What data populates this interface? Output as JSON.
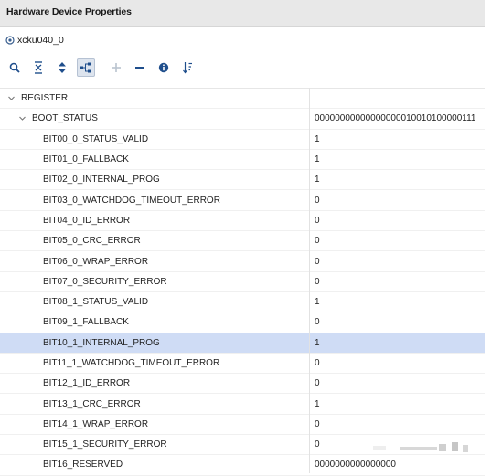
{
  "panel": {
    "title": "Hardware Device Properties",
    "device": "xcku040_0"
  },
  "toolbar": {
    "buttons": [
      {
        "name": "search",
        "icon": "search-icon"
      },
      {
        "name": "collapse-all",
        "icon": "collapse-all-icon"
      },
      {
        "name": "expand-all",
        "icon": "expand-all-icon"
      },
      {
        "name": "group",
        "icon": "hierarchy-icon",
        "active": true
      },
      {
        "name": "add",
        "icon": "plus-icon",
        "disabled": true
      },
      {
        "name": "remove",
        "icon": "minus-icon"
      },
      {
        "name": "info",
        "icon": "info-icon"
      },
      {
        "name": "sort",
        "icon": "sort-icon"
      }
    ]
  },
  "tree": {
    "root": {
      "name": "REGISTER",
      "value": ""
    },
    "group": {
      "name": "BOOT_STATUS",
      "value": "00000000000000000010010100000111"
    },
    "bits": [
      {
        "name": "BIT00_0_STATUS_VALID",
        "value": "1"
      },
      {
        "name": "BIT01_0_FALLBACK",
        "value": "1"
      },
      {
        "name": "BIT02_0_INTERNAL_PROG",
        "value": "1"
      },
      {
        "name": "BIT03_0_WATCHDOG_TIMEOUT_ERROR",
        "value": "0"
      },
      {
        "name": "BIT04_0_ID_ERROR",
        "value": "0"
      },
      {
        "name": "BIT05_0_CRC_ERROR",
        "value": "0"
      },
      {
        "name": "BIT06_0_WRAP_ERROR",
        "value": "0"
      },
      {
        "name": "BIT07_0_SECURITY_ERROR",
        "value": "0"
      },
      {
        "name": "BIT08_1_STATUS_VALID",
        "value": "1"
      },
      {
        "name": "BIT09_1_FALLBACK",
        "value": "0"
      },
      {
        "name": "BIT10_1_INTERNAL_PROG",
        "value": "1",
        "selected": true
      },
      {
        "name": "BIT11_1_WATCHDOG_TIMEOUT_ERROR",
        "value": "0"
      },
      {
        "name": "BIT12_1_ID_ERROR",
        "value": "0"
      },
      {
        "name": "BIT13_1_CRC_ERROR",
        "value": "1"
      },
      {
        "name": "BIT14_1_WRAP_ERROR",
        "value": "0"
      },
      {
        "name": "BIT15_1_SECURITY_ERROR",
        "value": "0"
      },
      {
        "name": "BIT16_RESERVED",
        "value": "0000000000000000"
      }
    ]
  },
  "colors": {
    "selection": "#cfdcf5",
    "header_bg": "#e8e8e8",
    "icon_blue": "#1f4e8c"
  }
}
